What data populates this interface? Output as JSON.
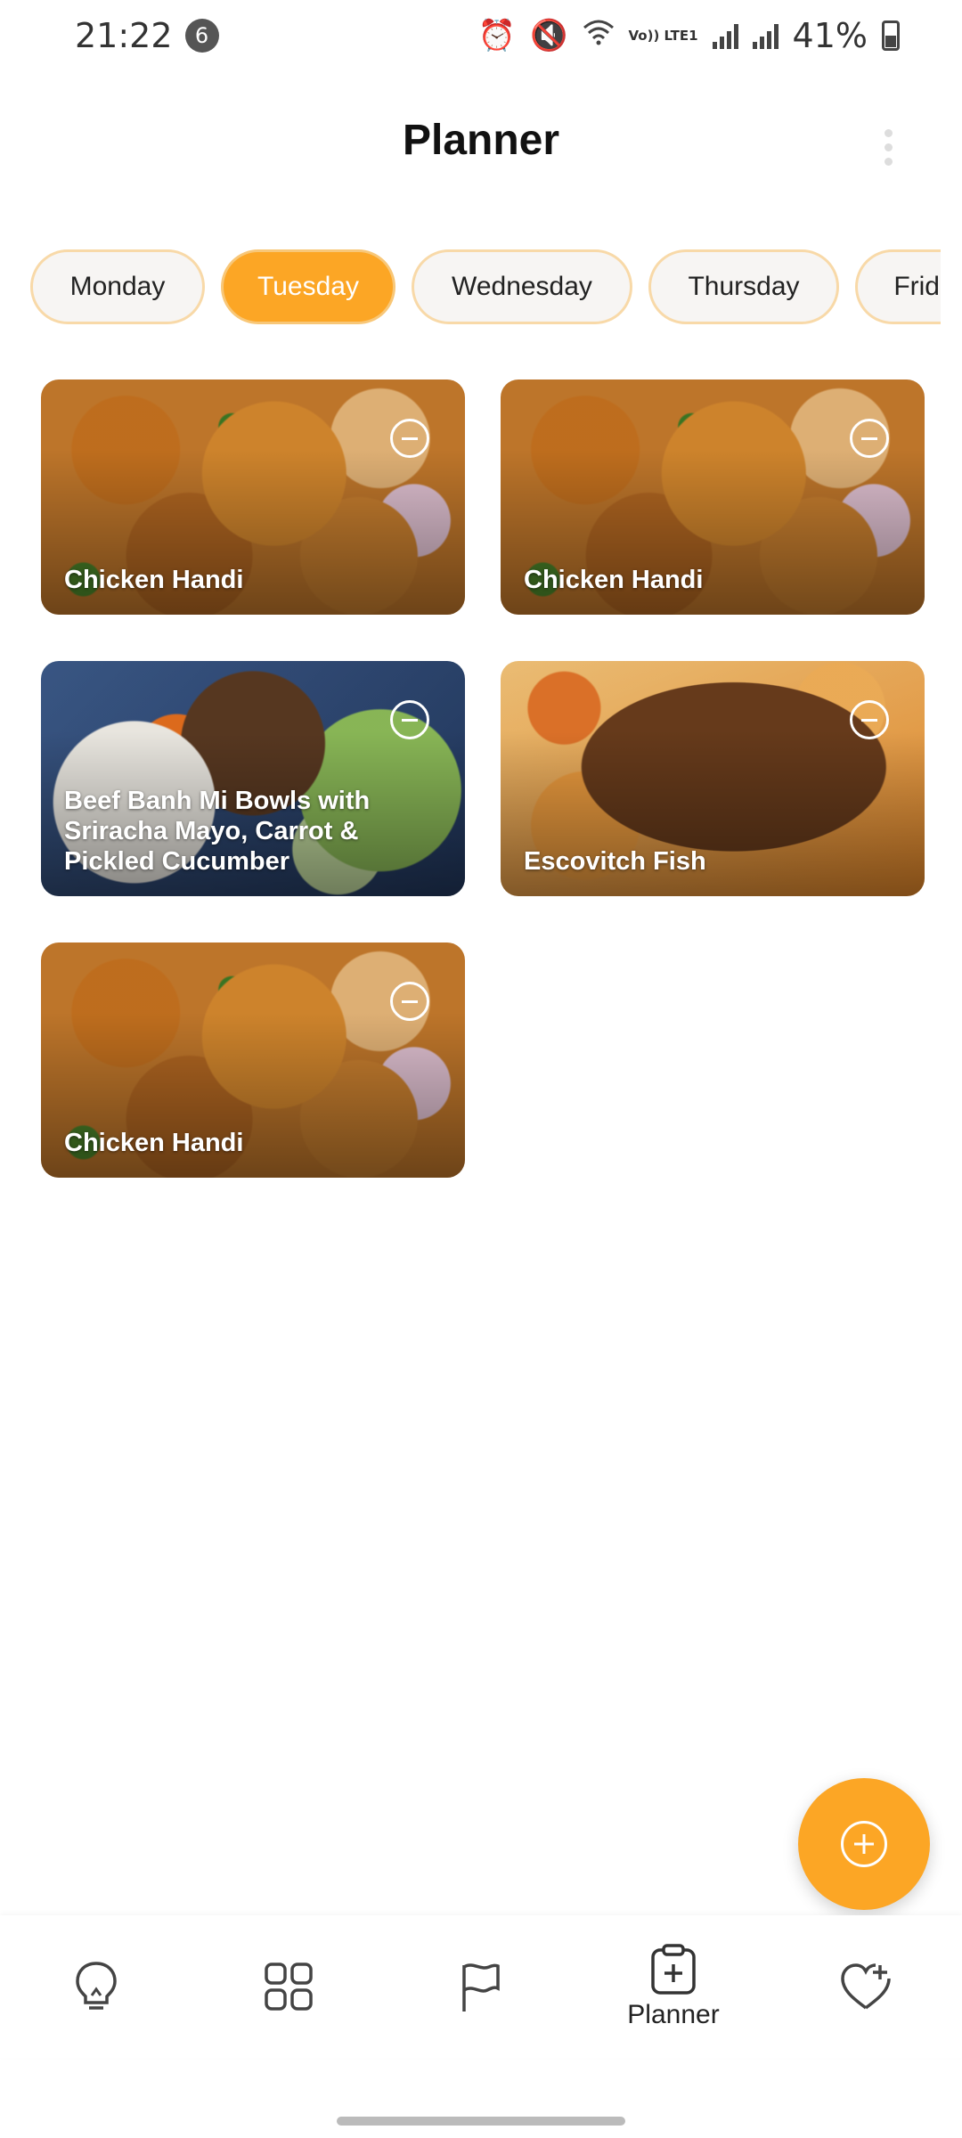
{
  "status_bar": {
    "time": "21:22",
    "notification_count": "6",
    "network": "Vo)) LTE1",
    "battery": "41%"
  },
  "header": {
    "title": "Planner"
  },
  "days": [
    {
      "label": "Monday",
      "selected": false
    },
    {
      "label": "Tuesday",
      "selected": true
    },
    {
      "label": "Wednesday",
      "selected": false
    },
    {
      "label": "Thursday",
      "selected": false
    },
    {
      "label": "Friday",
      "selected": false
    }
  ],
  "recipes": [
    {
      "name": "Chicken Handi",
      "image": "chicken-handi"
    },
    {
      "name": "Chicken Handi",
      "image": "chicken-handi"
    },
    {
      "name": "Beef Banh Mi Bowls with Sriracha Mayo, Carrot & Pickled Cucumber",
      "image": "beef-banh-mi"
    },
    {
      "name": "Escovitch Fish",
      "image": "escovitch-fish"
    },
    {
      "name": "Chicken Handi",
      "image": "chicken-handi"
    }
  ],
  "bottom_nav": {
    "items": [
      {
        "icon": "lightbulb-icon",
        "label": ""
      },
      {
        "icon": "grid-icon",
        "label": ""
      },
      {
        "icon": "flag-icon",
        "label": ""
      },
      {
        "icon": "clipboard-plus-icon",
        "label": "Planner",
        "active": true
      },
      {
        "icon": "heart-plus-icon",
        "label": ""
      }
    ]
  },
  "colors": {
    "accent": "#fca625",
    "tab_border": "#f8d9a8"
  }
}
